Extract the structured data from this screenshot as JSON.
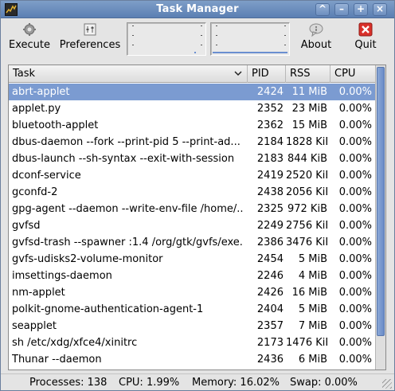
{
  "window": {
    "title": "Task Manager"
  },
  "titlebar_buttons": [
    "^",
    "–",
    "+",
    "×"
  ],
  "toolbar": {
    "execute_label": "Execute",
    "preferences_label": "Preferences",
    "about_label": "About",
    "quit_label": "Quit"
  },
  "icons": {
    "app": "task-manager-icon",
    "execute": "gear-icon",
    "preferences": "preferences-icon",
    "about": "speech-bubble-icon",
    "quit": "red-x-icon",
    "sort": "chevron-down-icon"
  },
  "columns": [
    "Task",
    "PID",
    "RSS",
    "CPU"
  ],
  "tasks": [
    {
      "task": "abrt-applet",
      "pid": "2424",
      "rss": "11 MiB",
      "cpu": "0.00%",
      "selected": true
    },
    {
      "task": "applet.py",
      "pid": "2352",
      "rss": "23 MiB",
      "cpu": "0.00%"
    },
    {
      "task": "bluetooth-applet",
      "pid": "2362",
      "rss": "15 MiB",
      "cpu": "0.00%"
    },
    {
      "task": "dbus-daemon --fork --print-pid 5 --print-ad...",
      "pid": "2184",
      "rss": "1828 KiB",
      "cpu": "0.00%"
    },
    {
      "task": "dbus-launch --sh-syntax --exit-with-session",
      "pid": "2183",
      "rss": "844 KiB",
      "cpu": "0.00%"
    },
    {
      "task": "dconf-service",
      "pid": "2419",
      "rss": "2520 KiB",
      "cpu": "0.00%"
    },
    {
      "task": "gconfd-2",
      "pid": "2438",
      "rss": "2056 KiB",
      "cpu": "0.00%"
    },
    {
      "task": "gpg-agent --daemon --write-env-file /home/...",
      "pid": "2325",
      "rss": "972 KiB",
      "cpu": "0.00%"
    },
    {
      "task": "gvfsd",
      "pid": "2249",
      "rss": "2756 KiB",
      "cpu": "0.00%"
    },
    {
      "task": "gvfsd-trash --spawner :1.4 /org/gtk/gvfs/exe...",
      "pid": "2386",
      "rss": "3476 KiB",
      "cpu": "0.00%"
    },
    {
      "task": "gvfs-udisks2-volume-monitor",
      "pid": "2454",
      "rss": "5 MiB",
      "cpu": "0.00%"
    },
    {
      "task": "imsettings-daemon",
      "pid": "2246",
      "rss": "4 MiB",
      "cpu": "0.00%"
    },
    {
      "task": "nm-applet",
      "pid": "2426",
      "rss": "16 MiB",
      "cpu": "0.00%"
    },
    {
      "task": "polkit-gnome-authentication-agent-1",
      "pid": "2404",
      "rss": "5 MiB",
      "cpu": "0.00%"
    },
    {
      "task": "seapplet",
      "pid": "2357",
      "rss": "7 MiB",
      "cpu": "0.00%"
    },
    {
      "task": "sh /etc/xdg/xfce4/xinitrc",
      "pid": "2173",
      "rss": "1476 KiB",
      "cpu": "0.00%"
    },
    {
      "task": "Thunar --daemon",
      "pid": "2436",
      "rss": "6 MiB",
      "cpu": "0.00%"
    }
  ],
  "status": {
    "processes": "Processes: 138",
    "cpu": "CPU: 1.99%",
    "memory": "Memory: 16.02%",
    "swap": "Swap: 0.00%"
  },
  "graphs": {
    "cpu_percent": 1.99,
    "memory_percent": 16.02
  },
  "colors": {
    "selection": "#7b9bd1",
    "titlebar": "#6a8cc0",
    "graph_fill": "#6a8fd0"
  }
}
